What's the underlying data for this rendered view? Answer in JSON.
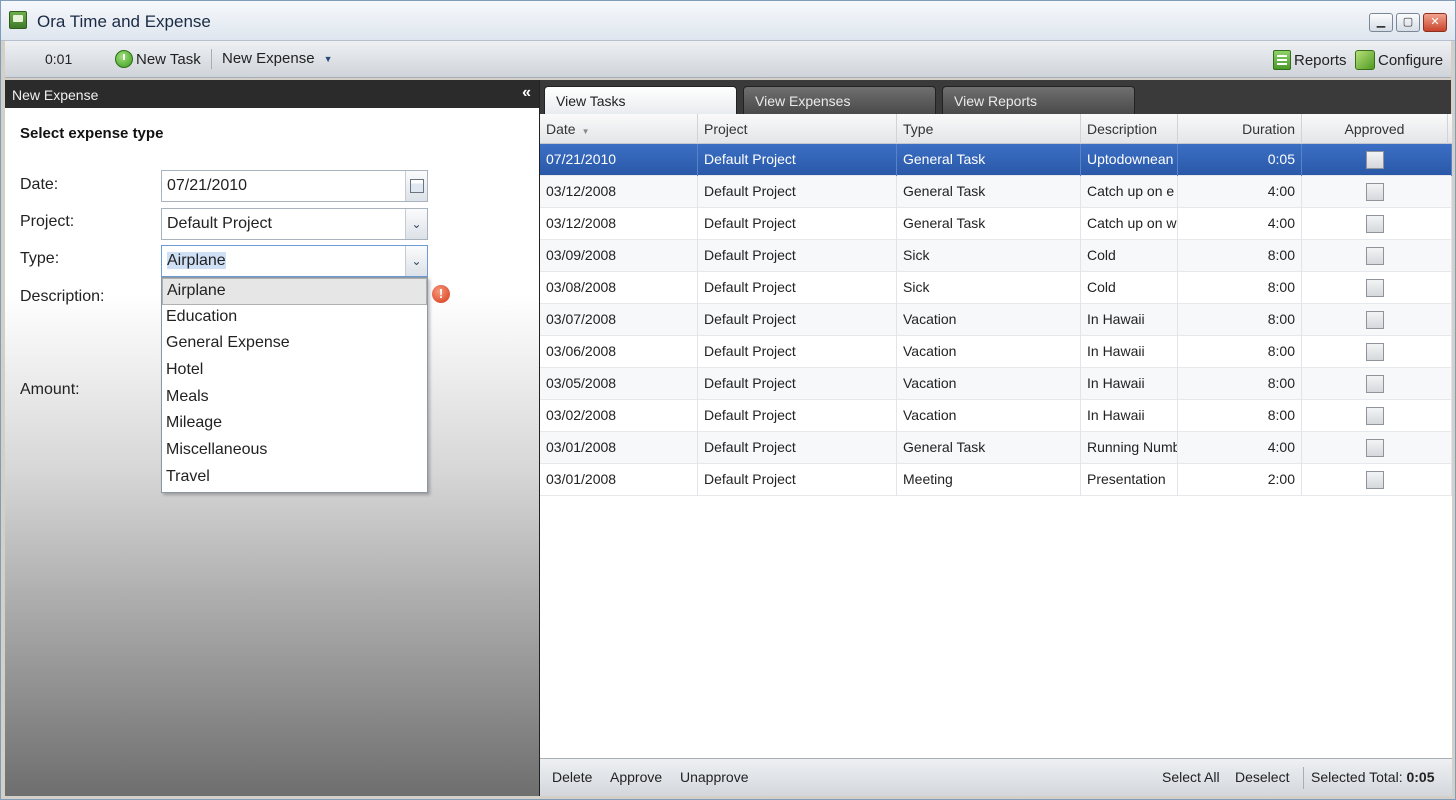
{
  "window": {
    "title": "Ora Time and Expense"
  },
  "toolbar": {
    "timer": "0:01",
    "new_task": "New Task",
    "new_expense": "New Expense",
    "reports": "Reports",
    "configure": "Configure"
  },
  "panel": {
    "header": "New Expense",
    "collapse": "«",
    "section_title": "Select expense type",
    "labels": {
      "date": "Date:",
      "project": "Project:",
      "type": "Type:",
      "description": "Description:",
      "amount": "Amount:"
    },
    "date_value": "07/21/2010",
    "project_value": "Default Project",
    "type_value": "Airplane",
    "error_icon": "!",
    "type_options": [
      "Airplane",
      "Education",
      "General Expense",
      "Hotel",
      "Meals",
      "Mileage",
      "Miscellaneous",
      "Travel"
    ]
  },
  "tabs": [
    "View Tasks",
    "View Expenses",
    "View Reports"
  ],
  "grid": {
    "columns": [
      "Date",
      "Project",
      "Type",
      "Description",
      "Duration",
      "Approved"
    ],
    "rows": [
      [
        "07/21/2010",
        "Default Project",
        "General Task",
        "Uptodownean",
        "0:05"
      ],
      [
        "03/12/2008",
        "Default Project",
        "General Task",
        "Catch up on e",
        "4:00"
      ],
      [
        "03/12/2008",
        "Default Project",
        "General Task",
        "Catch up on w",
        "4:00"
      ],
      [
        "03/09/2008",
        "Default Project",
        "Sick",
        "Cold",
        "8:00"
      ],
      [
        "03/08/2008",
        "Default Project",
        "Sick",
        "Cold",
        "8:00"
      ],
      [
        "03/07/2008",
        "Default Project",
        "Vacation",
        "In Hawaii",
        "8:00"
      ],
      [
        "03/06/2008",
        "Default Project",
        "Vacation",
        "In Hawaii",
        "8:00"
      ],
      [
        "03/05/2008",
        "Default Project",
        "Vacation",
        "In Hawaii",
        "8:00"
      ],
      [
        "03/02/2008",
        "Default Project",
        "Vacation",
        "In Hawaii",
        "8:00"
      ],
      [
        "03/01/2008",
        "Default Project",
        "General Task",
        "Running Numb",
        "4:00"
      ],
      [
        "03/01/2008",
        "Default Project",
        "Meeting",
        "Presentation",
        "2:00"
      ]
    ]
  },
  "bottom": {
    "delete": "Delete",
    "approve": "Approve",
    "unapprove": "Unapprove",
    "select_all": "Select All",
    "deselect": "Deselect",
    "selected_total_label": "Selected Total:",
    "selected_total_value": "0:05"
  }
}
